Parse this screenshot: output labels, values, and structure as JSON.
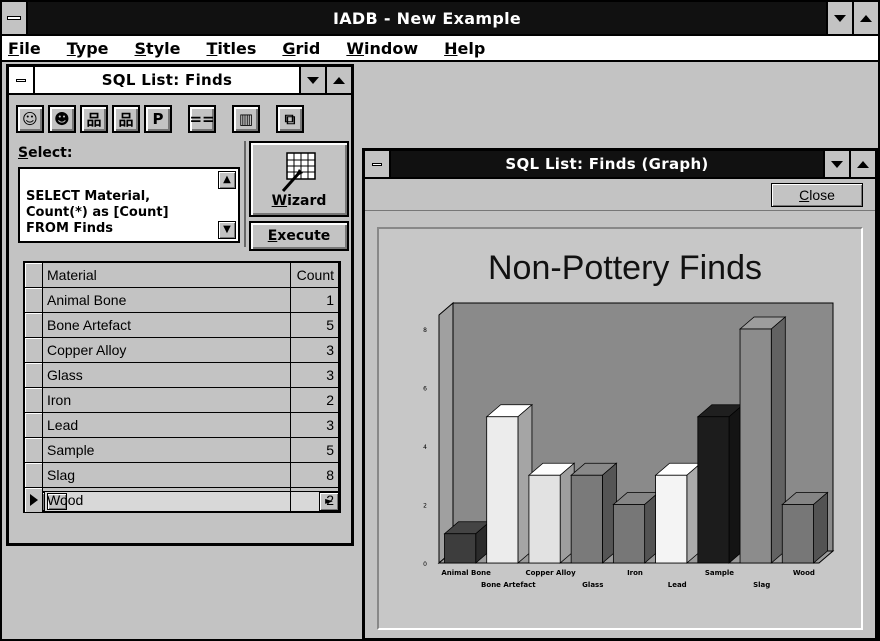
{
  "app": {
    "title": "IADB - New Example",
    "menu": [
      "File",
      "Type",
      "Style",
      "Titles",
      "Grid",
      "Window",
      "Help"
    ]
  },
  "list_window": {
    "title": "SQL List: Finds",
    "toolbar_icons": [
      "query-design-icon",
      "palette-icon",
      "tree-icon",
      "hierarchy-icon",
      "print-p-icon",
      "equals-icon",
      "bar-chart-icon",
      "copy-icon"
    ],
    "toolbar_glyphs": [
      "☺",
      "☻",
      "品",
      "品",
      "P",
      "==",
      "▥",
      "⧉"
    ],
    "select_label": "Select:",
    "sql_text": "SELECT Material,\nCount(*) as [Count]\nFROM Finds",
    "wizard_label": "Wizard",
    "execute_label": "Execute",
    "grid": {
      "headers": [
        "Material",
        "Count"
      ],
      "rows": [
        [
          "Animal Bone",
          "1"
        ],
        [
          "Bone Artefact",
          "5"
        ],
        [
          "Copper Alloy",
          "3"
        ],
        [
          "Glass",
          "3"
        ],
        [
          "Iron",
          "2"
        ],
        [
          "Lead",
          "3"
        ],
        [
          "Sample",
          "5"
        ],
        [
          "Slag",
          "8"
        ],
        [
          "Wood",
          "2"
        ]
      ],
      "current_row": 8
    }
  },
  "graph_window": {
    "title": "SQL List: Finds (Graph)",
    "close_label": "Close"
  },
  "colors": {
    "bars": [
      "#3d3d3d",
      "#ececec",
      "#e2e2e2",
      "#7a7a7a",
      "#777777",
      "#f4f4f4",
      "#1c1c1c",
      "#8c8c8c",
      "#777777"
    ],
    "plot_back": "#8a8a8a",
    "plot_wall": "#a0a0a0"
  },
  "chart_data": {
    "type": "bar",
    "title": "Non-Pottery Finds",
    "xlabel": "",
    "ylabel": "",
    "categories": [
      "Animal Bone",
      "Bone Artefact",
      "Copper Alloy",
      "Glass",
      "Iron",
      "Lead",
      "Sample",
      "Slag",
      "Wood"
    ],
    "values": [
      1,
      5,
      3,
      3,
      2,
      3,
      5,
      8,
      2
    ],
    "ylim": [
      0,
      8
    ],
    "yticks": [
      "0",
      "2",
      "4",
      "6",
      "8"
    ],
    "style": "3d",
    "grid": false,
    "legend": "none"
  }
}
